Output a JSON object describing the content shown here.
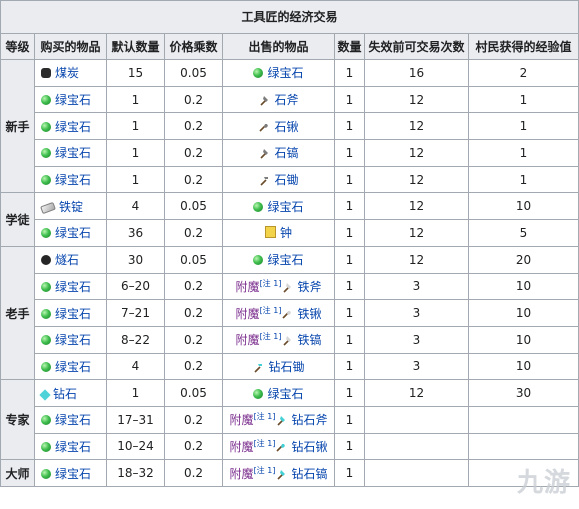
{
  "caption": "工具匠的经济交易",
  "headers": [
    "等级",
    "购买的物品",
    "默认数量",
    "价格乘数",
    "出售的物品",
    "数量",
    "失效前可交易次数",
    "村民获得的经验值"
  ],
  "enchant_prefix": "附魔",
  "note_label": "[注 1]",
  "tiers": [
    {
      "name": "新手",
      "rows": [
        {
          "buy": "煤炭",
          "buy_icon": "coal-icon",
          "qty": "15",
          "mult": "0.05",
          "sell": "绿宝石",
          "sell_icon": "emerald-icon",
          "sell_qty": "1",
          "uses": "16",
          "xp": "2"
        },
        {
          "buy": "绿宝石",
          "buy_icon": "emerald-icon",
          "qty": "1",
          "mult": "0.2",
          "sell": "石斧",
          "sell_icon": "stone-axe-icon",
          "sell_qty": "1",
          "uses": "12",
          "xp": "1"
        },
        {
          "buy": "绿宝石",
          "buy_icon": "emerald-icon",
          "qty": "1",
          "mult": "0.2",
          "sell": "石锹",
          "sell_icon": "stone-shovel-icon",
          "sell_qty": "1",
          "uses": "12",
          "xp": "1"
        },
        {
          "buy": "绿宝石",
          "buy_icon": "emerald-icon",
          "qty": "1",
          "mult": "0.2",
          "sell": "石镐",
          "sell_icon": "stone-pickaxe-icon",
          "sell_qty": "1",
          "uses": "12",
          "xp": "1"
        },
        {
          "buy": "绿宝石",
          "buy_icon": "emerald-icon",
          "qty": "1",
          "mult": "0.2",
          "sell": "石锄",
          "sell_icon": "stone-hoe-icon",
          "sell_qty": "1",
          "uses": "12",
          "xp": "1"
        }
      ]
    },
    {
      "name": "学徒",
      "rows": [
        {
          "buy": "铁锭",
          "buy_icon": "iron-ingot-icon",
          "qty": "4",
          "mult": "0.05",
          "sell": "绿宝石",
          "sell_icon": "emerald-icon",
          "sell_qty": "1",
          "uses": "12",
          "xp": "10"
        },
        {
          "buy": "绿宝石",
          "buy_icon": "emerald-icon",
          "qty": "36",
          "mult": "0.2",
          "sell": "钟",
          "sell_icon": "bell-icon",
          "sell_qty": "1",
          "uses": "12",
          "xp": "5"
        }
      ]
    },
    {
      "name": "老手",
      "rows": [
        {
          "buy": "燧石",
          "buy_icon": "flint-icon",
          "qty": "30",
          "mult": "0.05",
          "sell": "绿宝石",
          "sell_icon": "emerald-icon",
          "sell_qty": "1",
          "uses": "12",
          "xp": "20"
        },
        {
          "buy": "绿宝石",
          "buy_icon": "emerald-icon",
          "qty": "6–20",
          "mult": "0.2",
          "enchanted": true,
          "sell": "铁斧",
          "sell_icon": "iron-axe-icon",
          "sell_qty": "1",
          "uses": "3",
          "xp": "10"
        },
        {
          "buy": "绿宝石",
          "buy_icon": "emerald-icon",
          "qty": "7–21",
          "mult": "0.2",
          "enchanted": true,
          "sell": "铁锹",
          "sell_icon": "iron-shovel-icon",
          "sell_qty": "1",
          "uses": "3",
          "xp": "10"
        },
        {
          "buy": "绿宝石",
          "buy_icon": "emerald-icon",
          "qty": "8–22",
          "mult": "0.2",
          "enchanted": true,
          "sell": "铁镐",
          "sell_icon": "iron-pickaxe-icon",
          "sell_qty": "1",
          "uses": "3",
          "xp": "10"
        },
        {
          "buy": "绿宝石",
          "buy_icon": "emerald-icon",
          "qty": "4",
          "mult": "0.2",
          "sell": "钻石锄",
          "sell_icon": "diamond-hoe-icon",
          "sell_qty": "1",
          "uses": "3",
          "xp": "10"
        }
      ]
    },
    {
      "name": "专家",
      "rows": [
        {
          "buy": "钻石",
          "buy_icon": "diamond-icon",
          "qty": "1",
          "mult": "0.05",
          "sell": "绿宝石",
          "sell_icon": "emerald-icon",
          "sell_qty": "1",
          "uses": "12",
          "xp": "30"
        },
        {
          "buy": "绿宝石",
          "buy_icon": "emerald-icon",
          "qty": "17–31",
          "mult": "0.2",
          "enchanted": true,
          "sell": "钻石斧",
          "sell_icon": "diamond-axe-icon",
          "sell_qty": "1",
          "uses": "",
          "xp": ""
        },
        {
          "buy": "绿宝石",
          "buy_icon": "emerald-icon",
          "qty": "10–24",
          "mult": "0.2",
          "enchanted": true,
          "sell": "钻石锹",
          "sell_icon": "diamond-shovel-icon",
          "sell_qty": "1",
          "uses": "",
          "xp": ""
        }
      ]
    },
    {
      "name": "大师",
      "rows": [
        {
          "buy": "绿宝石",
          "buy_icon": "emerald-icon",
          "qty": "18–32",
          "mult": "0.2",
          "enchanted": true,
          "sell": "钻石镐",
          "sell_icon": "diamond-pickaxe-icon",
          "sell_qty": "1",
          "uses": "",
          "xp": ""
        }
      ]
    }
  ],
  "watermark": "九游"
}
